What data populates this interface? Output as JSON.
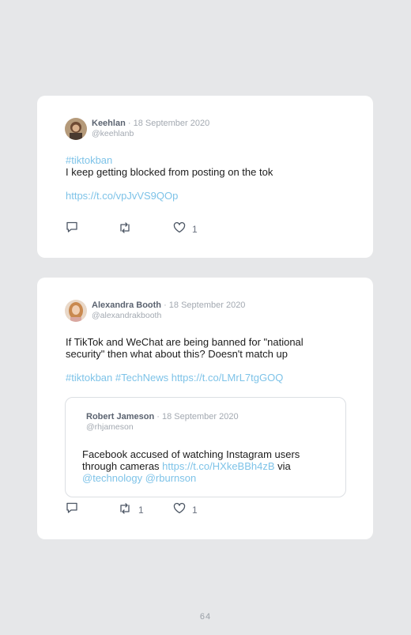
{
  "tweets": [
    {
      "author": "Keehlan",
      "date": "· 18 September 2020",
      "handle": "@keehlanb",
      "lines": [
        {
          "link": "#tiktokban"
        },
        {
          "text": "I keep getting blocked from posting on the tok"
        },
        {
          "link": "https://t.co/vpJvVS9QOp"
        }
      ],
      "retweets": "",
      "likes": "1"
    },
    {
      "author": "Alexandra Booth",
      "date": "· 18 September 2020",
      "handle": "@alexandrakbooth",
      "lines": [
        {
          "text": "If TikTok and WeChat are being banned for \"national"
        },
        {
          "text": "security\" then what about this? Doesn't match up"
        },
        {
          "link_a": "#tiktokban",
          "link_b": "#TechNews",
          "link_c": "https://t.co/LMrL7tgGOQ"
        }
      ],
      "quoted": {
        "author": "Robert Jameson",
        "date": "· 18 September 2020",
        "handle": "@rhjameson",
        "line1": "Facebook accused of watching Instagram users",
        "line2_text": "through cameras ",
        "line2_link": "https://t.co/HXkeBBh4zB",
        "line2_tail": " via",
        "line3_link_a": "@technology",
        "line3_link_b": "@rburnson"
      },
      "retweets": "1",
      "likes": "1"
    }
  ],
  "page_number": "64",
  "colors": {
    "background": "#e6e7e9",
    "card": "#ffffff",
    "link": "#7ec3e8",
    "author": "#5b6370",
    "muted": "#a3a9b1"
  },
  "icons": [
    "reply-icon",
    "retweet-icon",
    "like-icon"
  ]
}
